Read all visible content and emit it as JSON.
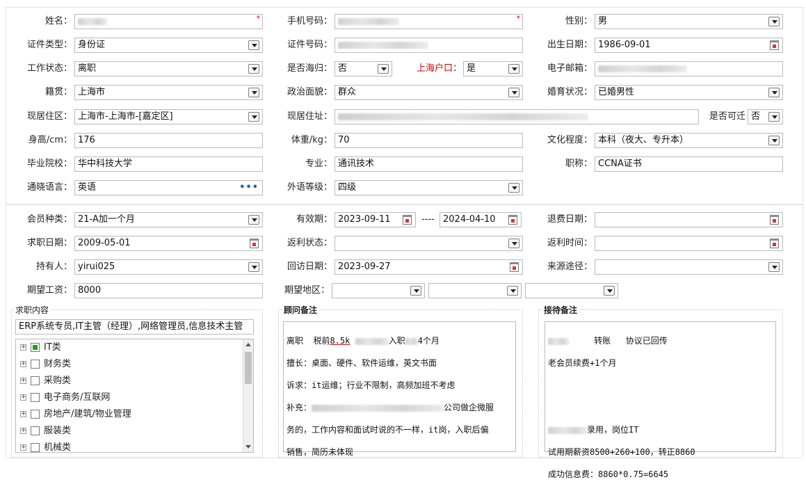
{
  "personal": {
    "name_label": "姓名：",
    "phone_label": "手机号码：",
    "gender_label": "性别：",
    "gender_value": "男",
    "id_type_label": "证件类型：",
    "id_type_value": "身份证",
    "id_no_label": "证件号码：",
    "birth_label": "出生日期：",
    "birth_value": "1986-09-01",
    "work_status_label": "工作状态：",
    "work_status_value": "离职",
    "overseas_label": "是否海归：",
    "overseas_value": "否",
    "hukou_label": "上海户口：",
    "hukou_value": "是",
    "email_label": "电子邮箱：",
    "native_label": "籍贯：",
    "native_value": "上海市",
    "political_label": "政治面貌：",
    "political_value": "群众",
    "marital_label": "婚育状况：",
    "marital_value": "已婚男性",
    "residence_label": "现居住区：",
    "residence_value": "上海市-上海市-[嘉定区]",
    "address_label": "现居住址：",
    "relocate_label": "是否可迁",
    "relocate_value": "否",
    "height_label": "身高/cm：",
    "height_value": "176",
    "weight_label": "体重/kg：",
    "weight_value": "70",
    "education_label": "文化程度：",
    "education_value": "本科（夜大、专升本）",
    "school_label": "毕业院校：",
    "school_value": "华中科技大学",
    "major_label": "专业：",
    "major_value": "通讯技术",
    "title_label": "职称：",
    "title_value": "CCNA证书",
    "language_label": "通晓语言：",
    "language_value": "英语",
    "language_more": "•••",
    "foreign_level_label": "外语等级：",
    "foreign_level_value": "四级"
  },
  "membership": {
    "member_type_label": "会员种类：",
    "member_type_value": "21-A加一个月",
    "valid_label": "有效期：",
    "valid_from": "2023-09-11",
    "valid_sep": "----",
    "valid_to": "2024-04-10",
    "refund_date_label": "退费日期：",
    "job_date_label": "求职日期：",
    "job_date_value": "2009-05-01",
    "rebate_status_label": "返利状态：",
    "rebate_time_label": "返利时间：",
    "holder_label": "持有人：",
    "holder_value": "yirui025",
    "visit_date_label": "回访日期：",
    "visit_date_value": "2023-09-27",
    "source_label": "来源途径：",
    "salary_label": "期望工资：",
    "salary_value": "8000",
    "area_label": "期望地区："
  },
  "job_content": {
    "title": "求职内容",
    "summary": "ERP系统专员,IT主管（经理）,网络管理员,信息技术主管",
    "tree_items": [
      "IT类",
      "财务类",
      "采购类",
      "电子商务/互联网",
      "房地产/建筑/物业管理",
      "服装类",
      "机械类"
    ]
  },
  "consultant_notes": {
    "title": "顾问备注",
    "line1_a": "离职  税前",
    "line1_b": "8.5k",
    "line1_c": "入职",
    "line1_d": "4个月",
    "line2": "擅长：桌面、硬件、软件运维，英文书面",
    "line3": "诉求：it运维；行业不限制，高频加班不考虑",
    "line4_a": "补充：",
    "line4_b": "公司做企微服",
    "line5": "务的，工作内容和面试时说的不一样，it岗，入职后偏",
    "line6": "销售，简历未体现"
  },
  "reception_notes": {
    "title": "接待备注",
    "line1_a": "转账   协议已回传",
    "line2": "老会员续费+1个月",
    "line3_b": "录用，岗位IT",
    "line4": "试用期薪资8500+260+100，转正8860",
    "line5": "成功信息费：8860*0.75=6645"
  },
  "colors": {
    "required": "#e00000",
    "hukou_label": "#d00000",
    "tree_partial": "#1aa31a",
    "dots": "#2a5db0"
  }
}
